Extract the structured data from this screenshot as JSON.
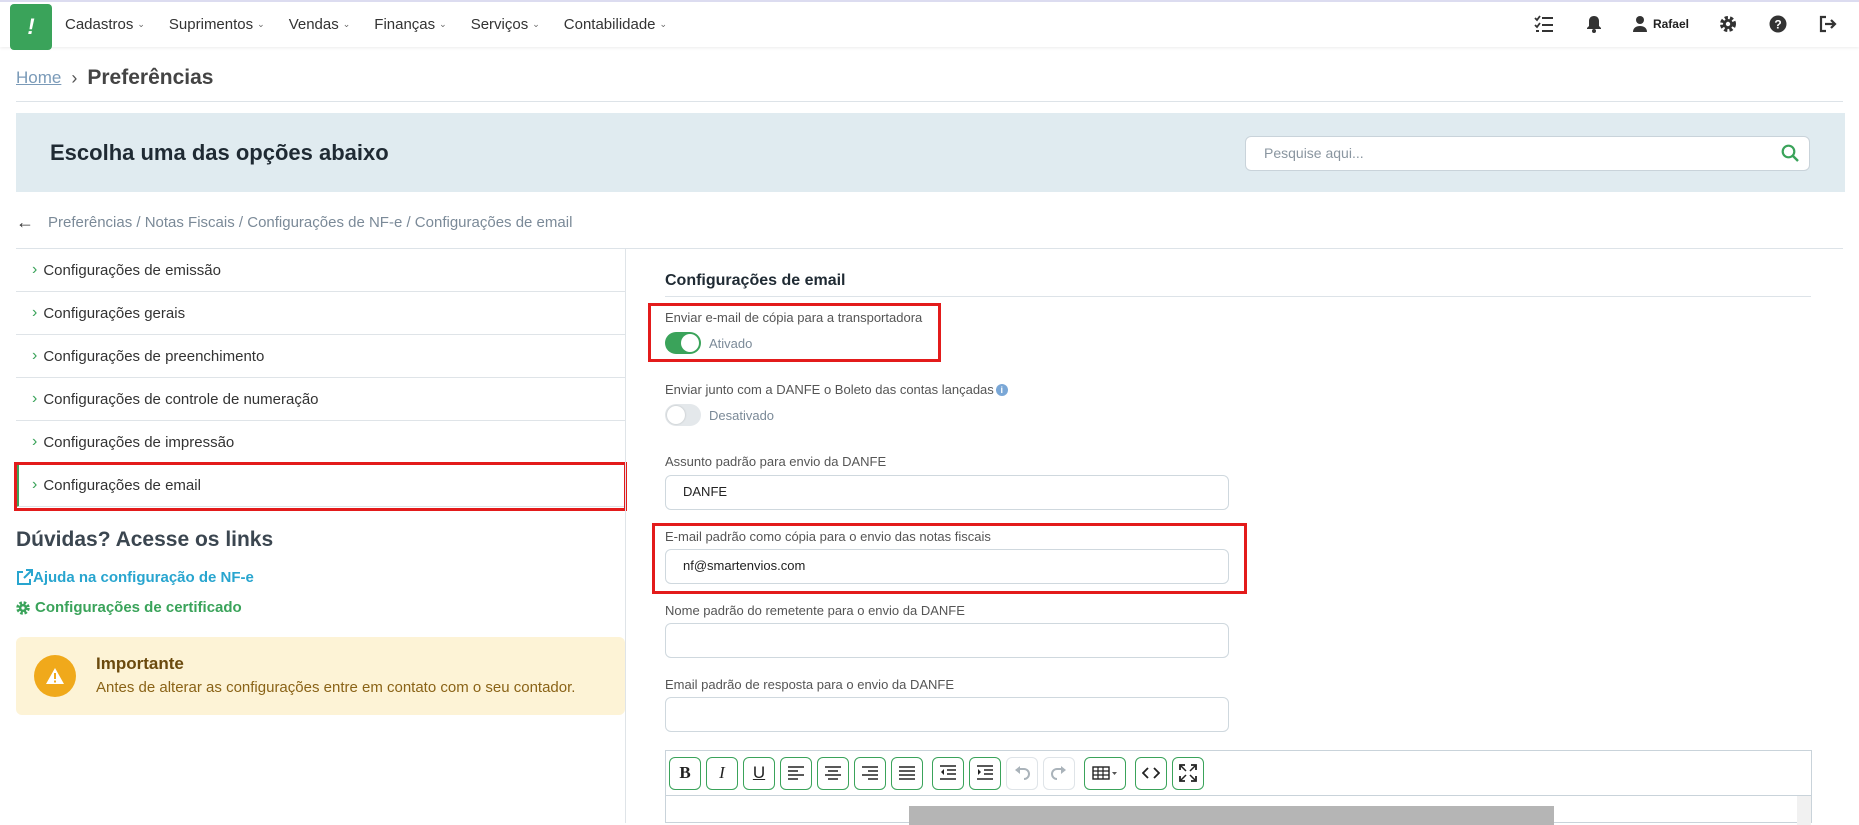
{
  "nav": {
    "logo_text": "!",
    "items": [
      {
        "label": "Cadastros"
      },
      {
        "label": "Suprimentos"
      },
      {
        "label": "Vendas"
      },
      {
        "label": "Finanças"
      },
      {
        "label": "Serviços"
      },
      {
        "label": "Contabilidade"
      }
    ],
    "user_name": "Rafael",
    "right_icons": [
      "checklist-icon",
      "bell-icon",
      "user-icon",
      "gear-icon",
      "help-icon",
      "logout-icon"
    ]
  },
  "header": {
    "home_link": "Home",
    "title": "Preferências"
  },
  "banner": {
    "title": "Escolha uma das opções abaixo",
    "search_placeholder": "Pesquise aqui..."
  },
  "path": "Preferências / Notas Fiscais / Configurações de NF-e / Configurações de email",
  "menu": {
    "items": [
      {
        "label": "Configurações de emissão"
      },
      {
        "label": "Configurações gerais"
      },
      {
        "label": "Configurações de preenchimento"
      },
      {
        "label": "Configurações de controle de numeração"
      },
      {
        "label": "Configurações de impressão"
      },
      {
        "label": "Configurações de email"
      }
    ]
  },
  "help": {
    "title": "Dúvidas? Acesse os links",
    "link1": "Ajuda na configuração de NF-e",
    "link2": "Configurações de certificado"
  },
  "important": {
    "title": "Importante",
    "text": "Antes de alterar as configurações entre em contato com o seu contador."
  },
  "form": {
    "section_title": "Configurações de email",
    "copy_carrier_label": "Enviar e-mail de cópia para a transportadora",
    "copy_carrier_state": "Ativado",
    "send_boleto_label": "Enviar junto com a DANFE o Boleto das contas lançadas",
    "send_boleto_state": "Desativado",
    "subject_label": "Assunto padrão para envio da DANFE",
    "subject_value": "DANFE",
    "cc_email_label": "E-mail padrão como cópia para o envio das notas fiscais",
    "cc_email_value": "nf@smartenvios.com",
    "sender_name_label": "Nome padrão do remetente para o envio da DANFE",
    "sender_name_value": "",
    "reply_email_label": "Email padrão de resposta para o envio da DANFE",
    "reply_email_value": ""
  },
  "colors": {
    "brand_green": "#3aa35a",
    "highlight_red": "#e31b1b",
    "banner_bg": "#e0ebf0",
    "warning_bg": "#fdf3d6"
  }
}
